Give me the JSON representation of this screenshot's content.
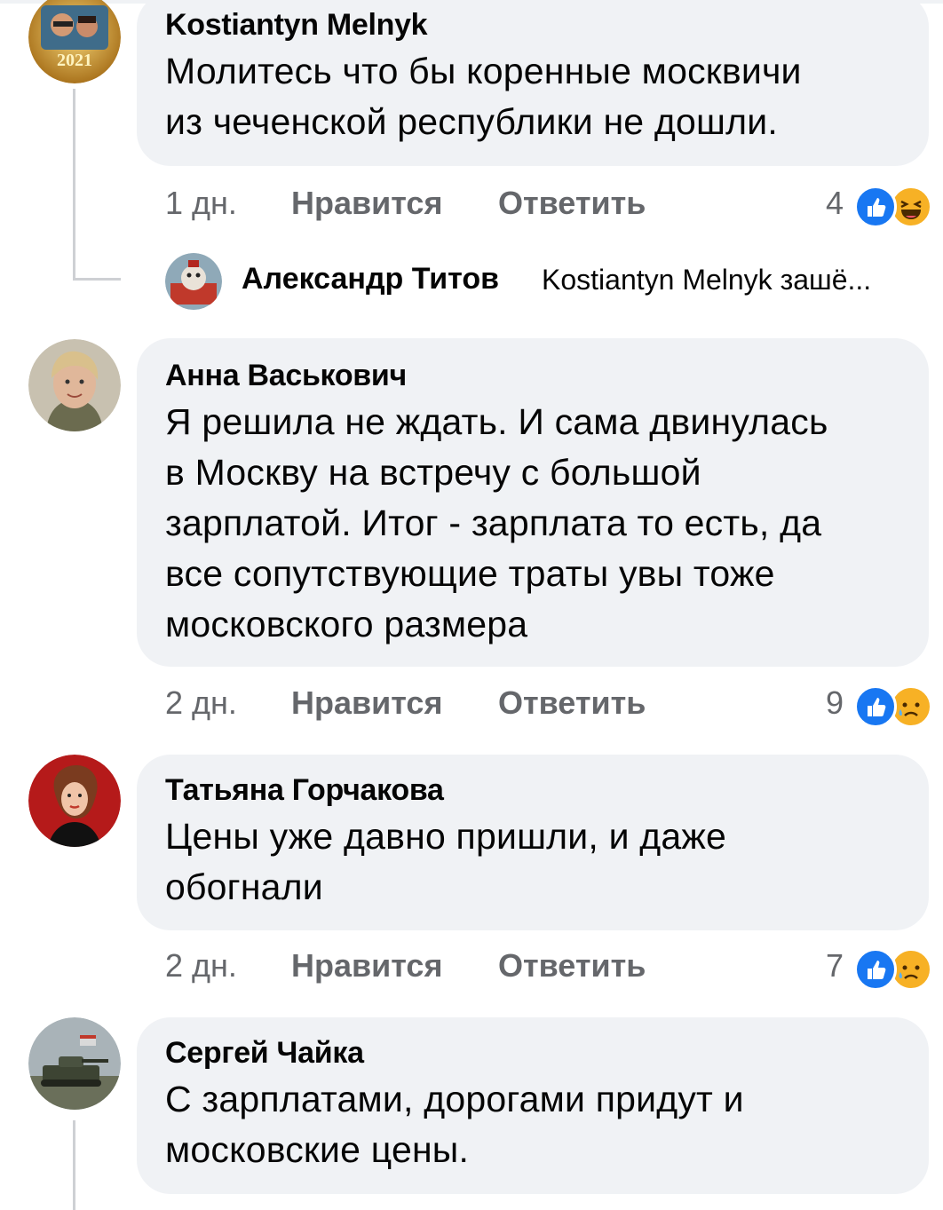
{
  "comments": [
    {
      "author": "Kostiantyn Melnyk",
      "text_lines": [
        "Молитесь что бы коренные москвичи",
        "из чеченской республики не дошли."
      ],
      "time": "1 дн.",
      "like_label": "Нравится",
      "reply_label": "Ответить",
      "reaction_count": "4",
      "reactions": [
        "like-icon",
        "haha-icon"
      ],
      "avatar_badge": "2021",
      "replies": [
        {
          "author": "Александр Титов",
          "preview": "Kostiantyn Melnyk зашё..."
        }
      ]
    },
    {
      "author": "Анна Васькович",
      "text_lines": [
        "Я решила не ждать. И сама двинулась",
        "в Москву на встречу с большой",
        "зарплатой.  Итог - зарплата то есть, да",
        "все сопутствующие траты увы тоже",
        "московского размера"
      ],
      "time": "2 дн.",
      "like_label": "Нравится",
      "reply_label": "Ответить",
      "reaction_count": "9",
      "reactions": [
        "like-icon",
        "sad-icon"
      ]
    },
    {
      "author": "Татьяна Горчакова",
      "text_lines": [
        "Цены уже давно пришли, и даже",
        "обогнали"
      ],
      "time": "2 дн.",
      "like_label": "Нравится",
      "reply_label": "Ответить",
      "reaction_count": "7",
      "reactions": [
        "like-icon",
        "sad-icon"
      ]
    },
    {
      "author": "Сергей Чайка",
      "text_lines": [
        "С зарплатами, дорогами придут и",
        "московские цены."
      ]
    }
  ],
  "colors": {
    "bubble": "#f0f2f5",
    "meta_text": "#65676b",
    "like_blue": "#1877f2",
    "emoji_yellow": "#f7b125"
  }
}
